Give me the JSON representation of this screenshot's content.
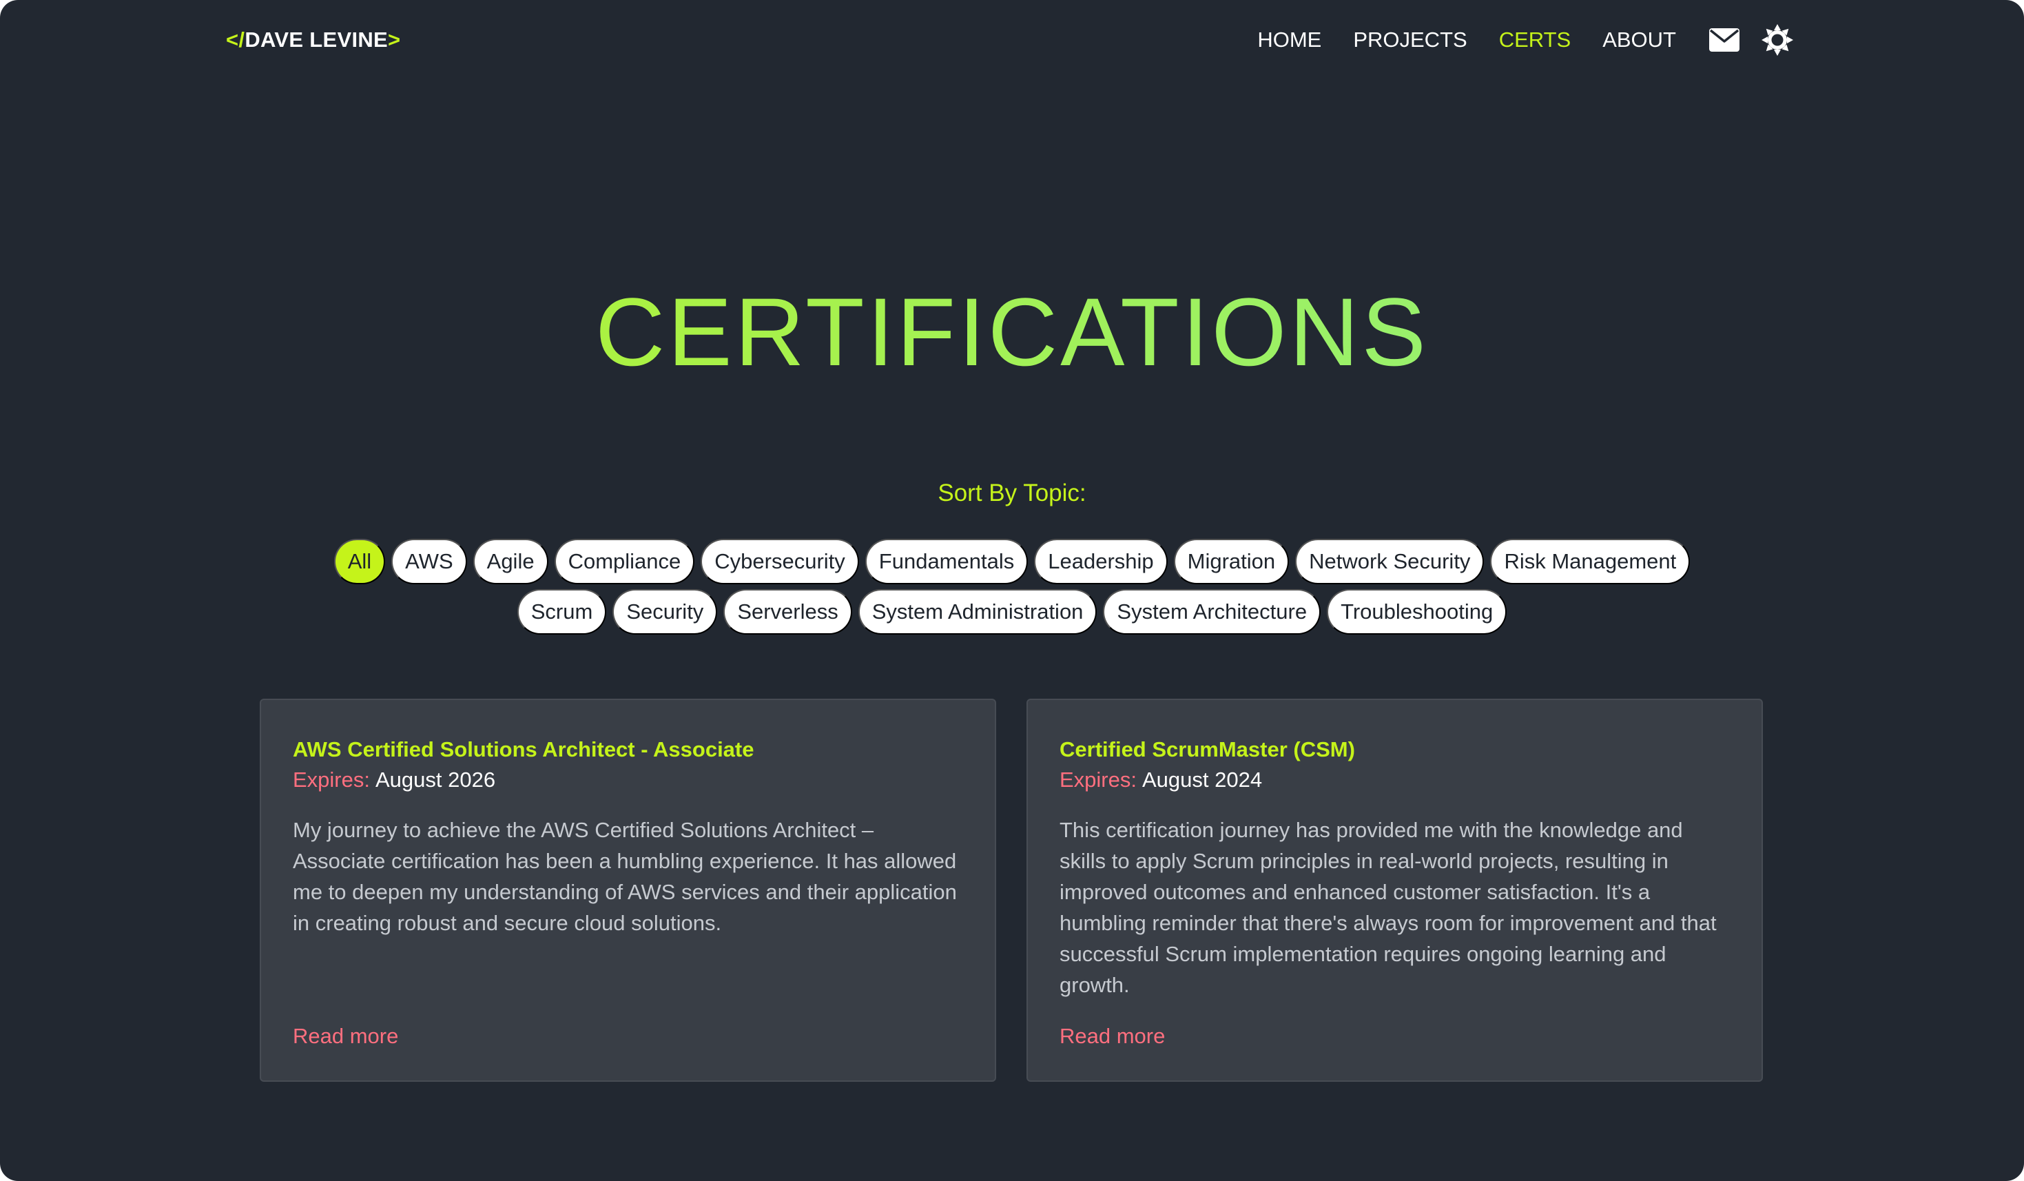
{
  "nav": {
    "logo_open": "</",
    "logo_name": "DAVE LEVINE",
    "logo_close": ">",
    "links": {
      "home": "HOME",
      "projects": "PROJECTS",
      "certs": "CERTS",
      "about": "ABOUT"
    },
    "active_link": "CERTS",
    "icons": [
      "envelope-icon",
      "sun-gear-icon"
    ]
  },
  "page": {
    "title": "CERTIFICATIONS",
    "sort_label": "Sort By Topic:"
  },
  "topics": {
    "row1": [
      "All",
      "AWS",
      "Agile",
      "Compliance",
      "Cybersecurity",
      "Fundamentals",
      "Leadership",
      "Migration",
      "Network Security",
      "Risk Management"
    ],
    "row2": [
      "Scrum",
      "Security",
      "Serverless",
      "System Administration",
      "System Architecture",
      "Troubleshooting"
    ],
    "active": "All"
  },
  "cards": [
    {
      "title": "AWS Certified Solutions Architect - Associate",
      "expires_label": "Expires:",
      "expires": "August 2026",
      "description": "My journey to achieve the AWS Certified Solutions Architect – Associate certification has been a humbling experience. It has allowed me to deepen my understanding of AWS services and their application in creating robust and secure cloud solutions.",
      "read_more": "Read more"
    },
    {
      "title": "Certified ScrumMaster (CSM)",
      "expires_label": "Expires:",
      "expires": "August 2024",
      "description": "This certification journey has provided me with the knowledge and skills to apply Scrum principles in real-world projects, resulting in improved outcomes and enhanced customer satisfaction. It's a humbling reminder that there's always room for improvement and that successful Scrum implementation requires ongoing learning and growth.",
      "read_more": "Read more"
    }
  ],
  "colors": {
    "background": "#222831",
    "card": "#393e46",
    "accent": "#c5f31a",
    "link_red": "#ff6f7f"
  }
}
